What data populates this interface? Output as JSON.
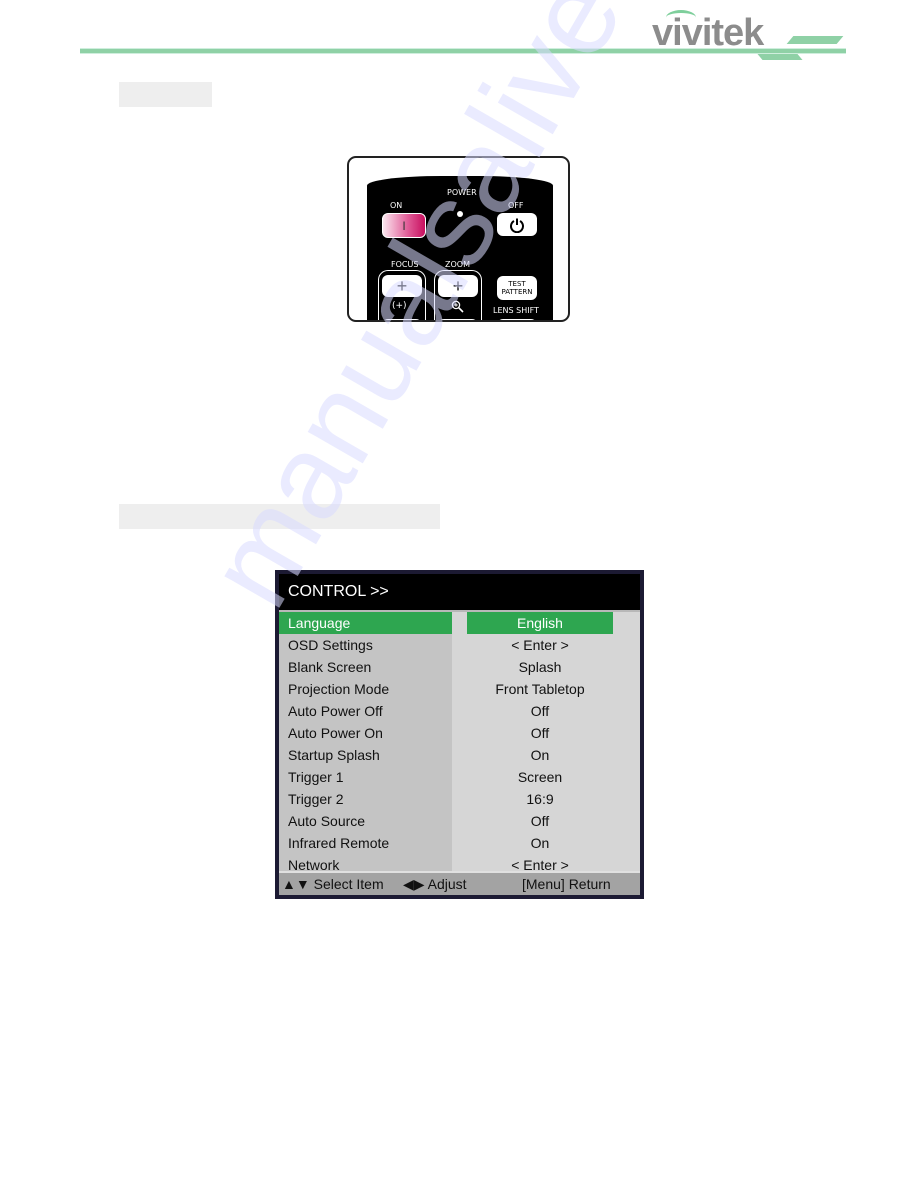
{
  "header": {
    "brand_logo": "vivitek",
    "brand_color": "#8fd1a6",
    "logo_text_color": "#8c8c8c"
  },
  "sections": [
    {
      "heading": ""
    },
    {
      "heading": ""
    }
  ],
  "remote": {
    "power_label": "POWER",
    "on_label": "ON",
    "on_button_glyph": "I",
    "off_label": "OFF",
    "off_button_icon": "power-icon",
    "focus_label": "FOCUS",
    "focus_plus": "+",
    "focus_icon_glyph": "(+)",
    "zoom_label": "ZOOM",
    "zoom_plus": "+",
    "zoom_icon": "magnifier-plus-icon",
    "test_pattern_line1": "TEST",
    "test_pattern_line2": "PATTERN",
    "lens_shift_label": "LENS SHIFT",
    "on_button_color": "#d8307a"
  },
  "osd": {
    "title": "CONTROL >>",
    "highlight_color": "#2ea650",
    "rows": [
      {
        "label": "Language",
        "value": "English",
        "selected": true
      },
      {
        "label": "OSD Settings",
        "value": "< Enter >"
      },
      {
        "label": "Blank Screen",
        "value": "Splash"
      },
      {
        "label": "Projection Mode",
        "value": "Front Tabletop"
      },
      {
        "label": "Auto Power Off",
        "value": "Off"
      },
      {
        "label": "Auto Power On",
        "value": "Off"
      },
      {
        "label": "Startup Splash",
        "value": "On"
      },
      {
        "label": "Trigger 1",
        "value": "Screen"
      },
      {
        "label": "Trigger 2",
        "value": "16:9"
      },
      {
        "label": "Auto Source",
        "value": "Off"
      },
      {
        "label": "Infrared Remote",
        "value": "On"
      },
      {
        "label": "Network",
        "value": "< Enter >"
      }
    ],
    "footer": {
      "select_hint": "▲▼ Select Item",
      "adjust_hint": "◀▶ Adjust",
      "return_hint": "[Menu] Return"
    }
  },
  "watermark": "manualsalive.com"
}
